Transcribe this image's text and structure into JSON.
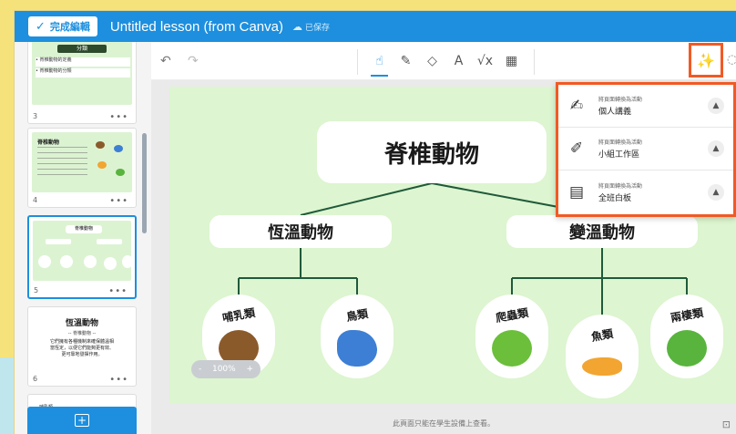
{
  "header": {
    "done_label": "完成編輯",
    "title": "Untitled lesson (from Canva)",
    "saved_label": "已保存"
  },
  "sidebar": {
    "slides": [
      {
        "num": "3",
        "heading": "分類",
        "lines": [
          "• 脊椎動物的定義",
          "• 脊椎動物的分類"
        ]
      },
      {
        "num": "4",
        "heading": "脊椎動物",
        "lines": []
      },
      {
        "num": "5",
        "heading": "脊椎動物",
        "lines": []
      },
      {
        "num": "6",
        "heading": "恆溫動物",
        "lines": [
          "-- 脊椎動物 --",
          "它們擁有各種機制來確保體溫相",
          "當恆定，以便它們能夠更有效、",
          "更可靠地發揮作用。"
        ]
      },
      {
        "num": "",
        "heading": "哺乳類",
        "lines": []
      }
    ],
    "more_label": "•••"
  },
  "toolbar": {
    "tools": [
      "pointer-icon",
      "pen-icon",
      "eraser-icon",
      "text-icon",
      "formula-icon",
      "shapes-icon"
    ]
  },
  "canvas": {
    "root": "脊椎動物",
    "left_branch": "恆溫動物",
    "right_branch": "變溫動物",
    "leaves": [
      {
        "label": "哺乳類",
        "color": "#8b5a2b"
      },
      {
        "label": "鳥類",
        "color": "#3d7fd4"
      },
      {
        "label": "爬蟲類",
        "color": "#6bbf3b"
      },
      {
        "label": "魚類",
        "color": "#f2a531"
      },
      {
        "label": "兩棲類",
        "color": "#58b43d"
      }
    ],
    "zoom": {
      "minus": "-",
      "value": "100%",
      "plus": "+"
    },
    "footer_note": "此頁面只能在學生設備上查看。"
  },
  "popup": {
    "items": [
      {
        "small": "將頁面轉換為活動",
        "big": "個人講義"
      },
      {
        "small": "將頁面轉換為活動",
        "big": "小組工作區"
      },
      {
        "small": "將頁面轉換為活動",
        "big": "全班白板"
      }
    ]
  },
  "colors": {
    "accent": "#1d8fde",
    "highlight": "#f15a24",
    "slide_bg": "#ddf5d0"
  }
}
